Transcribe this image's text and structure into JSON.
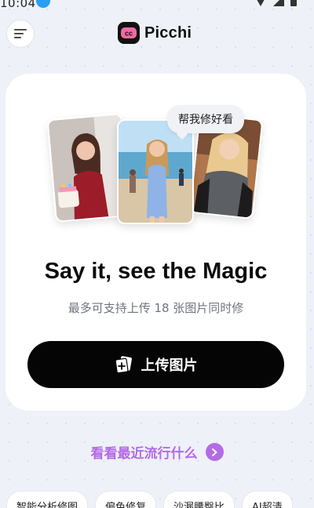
{
  "status_bar": {
    "time": "10:04"
  },
  "header": {
    "app_name": "Picchi",
    "menu_icon": "hamburger-menu-icon",
    "logo_icon": "picchi-logo-icon"
  },
  "hero": {
    "speech_bubble": "帮我修好看",
    "title": "Say it, see the Magic",
    "subtitle": "最多可支持上传 18 张图片同时修"
  },
  "upload_button": {
    "label": "上传图片",
    "icon": "add-photo-icon"
  },
  "trending": {
    "label": "看看最近流行什么",
    "icon": "chevron-right-circle-icon",
    "color": "#b36be6"
  },
  "chips": [
    "智能分析修图",
    "偏色修复",
    "沙漏腰臀比",
    "AI超清"
  ]
}
